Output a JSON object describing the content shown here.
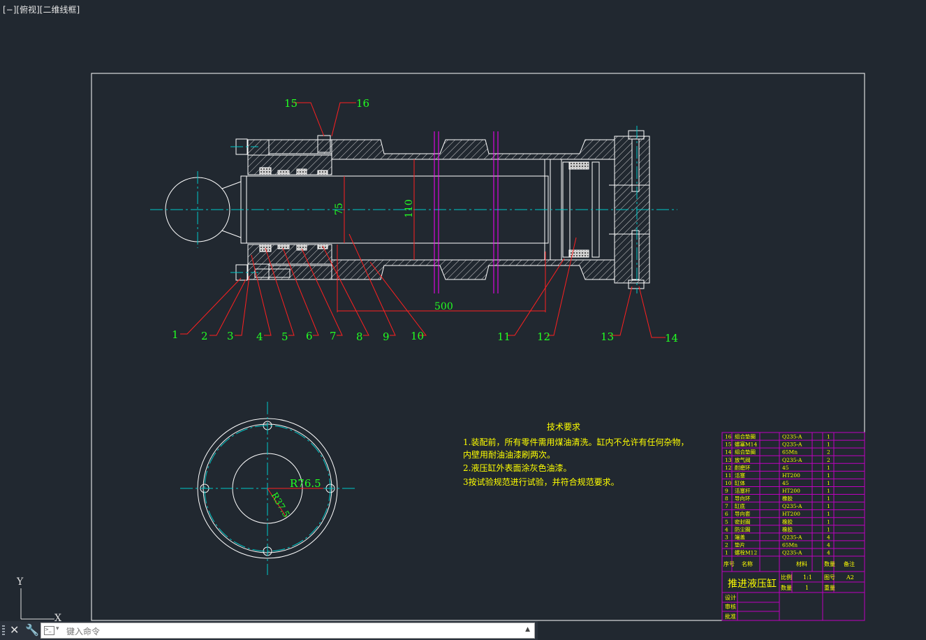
{
  "viewport_label": "[−][俯视][二维线框]",
  "command_line": {
    "placeholder": "键入命令"
  },
  "colors": {
    "background": "#212830",
    "frame": "#ffffff",
    "leader": "#ff2020",
    "label": "#22ff22",
    "centerline": "#00c8c8",
    "section": "#ff00ff",
    "note": "#ffff00",
    "title_block": "#c000c0"
  },
  "ucs_icon": {
    "y_label": "Y",
    "x_label": "X"
  },
  "part_labels": [
    "1",
    "2",
    "3",
    "4",
    "5",
    "6",
    "7",
    "8",
    "9",
    "10",
    "11",
    "12",
    "13",
    "14",
    "15",
    "16"
  ],
  "dimensions": {
    "rod_dia": "75",
    "bore_dia": "110",
    "stroke": "500",
    "outer_radius": "R76.5",
    "inner_radius": "R37.5"
  },
  "technical_requirements": {
    "title": "技术要求",
    "lines": [
      "1.装配前，所有零件需用煤油清洗。缸内不允许有任何杂物，",
      "内壁用耐油油漆刷两次。",
      "2.液压缸外表面涂灰色油漆。",
      "3按试验规范进行试验，并符合规范要求。"
    ]
  },
  "title_block": {
    "drawing_name": "推进液压缸",
    "rows": [
      {
        "no": "16",
        "name": "组合垫圈",
        "material": "Q235-A",
        "qty": "1"
      },
      {
        "no": "15",
        "name": "螺塞M14",
        "material": "Q235-A",
        "qty": "1"
      },
      {
        "no": "14",
        "name": "组合垫圈",
        "material": "65Mn",
        "qty": "2"
      },
      {
        "no": "13",
        "name": "放气阀",
        "material": "Q235-A",
        "qty": "2"
      },
      {
        "no": "12",
        "name": "耐磨环",
        "material": "45",
        "qty": "1"
      },
      {
        "no": "11",
        "name": "活塞",
        "material": "HT200",
        "qty": "1"
      },
      {
        "no": "10",
        "name": "缸体",
        "material": "45",
        "qty": "1"
      },
      {
        "no": "9",
        "name": "活塞杆",
        "material": "HT200",
        "qty": "1"
      },
      {
        "no": "8",
        "name": "导向环",
        "material": "橡胶",
        "qty": "1"
      },
      {
        "no": "7",
        "name": "缸底",
        "material": "Q235-A",
        "qty": "1"
      },
      {
        "no": "6",
        "name": "导向套",
        "material": "HT200",
        "qty": "1"
      },
      {
        "no": "5",
        "name": "密封圈",
        "material": "橡胶",
        "qty": "1"
      },
      {
        "no": "4",
        "name": "防尘圈",
        "material": "橡胶",
        "qty": "1"
      },
      {
        "no": "3",
        "name": "端盖",
        "material": "Q235-A",
        "qty": "4"
      },
      {
        "no": "2",
        "name": "垫片",
        "material": "65Mn",
        "qty": "4"
      },
      {
        "no": "1",
        "name": "螺栓M12",
        "material": "Q235-A",
        "qty": "4"
      }
    ],
    "header": {
      "no": "序号",
      "name": "名称",
      "material": "材料",
      "qty": "数量",
      "remark": "备注"
    },
    "scale_label": "比例",
    "scale_value": "1:1",
    "drawing_no_label": "图号",
    "drawing_no_value": "A2",
    "quantity_label": "数量",
    "quantity_value": "1",
    "weight_label": "重量",
    "design_label": "设计",
    "check_label": "审核",
    "approve_label": "批准"
  }
}
